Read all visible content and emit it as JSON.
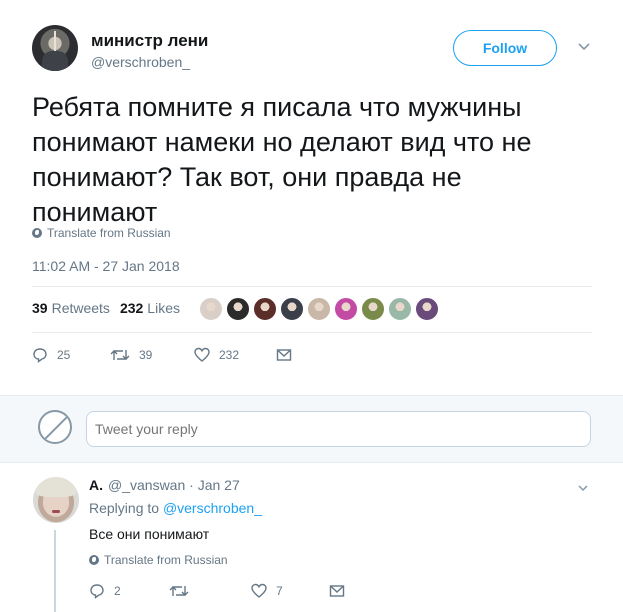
{
  "tweet": {
    "display_name": "министр лени",
    "handle": "@verschroben_",
    "follow_label": "Follow",
    "text": "Ребята помните я писала что мужчины понимают намеки но делают вид что не понимают? Так вот, они правда не понимают",
    "translate_label": "Translate from Russian",
    "timestamp": "11:02 AM - 27 Jan 2018",
    "retweets_count": "39",
    "retweets_label": "Retweets",
    "likes_count": "232",
    "likes_label": "Likes",
    "actions": {
      "replies": "25",
      "retweets": "39",
      "likes": "232"
    },
    "liker_colors": [
      "#d9cfc8",
      "#2b2b2b",
      "#5b2e2a",
      "#3a3f4a",
      "#c9b8a8",
      "#c44ba3",
      "#7a8a4a",
      "#9ab8a8",
      "#6a4a7a"
    ]
  },
  "reply_box": {
    "placeholder": "Tweet your reply"
  },
  "reply": {
    "name": "A.",
    "meta": "@_vanswan · Jan 27",
    "replying_prefix": "Replying to",
    "replying_to": "@verschroben_",
    "text": "Все они понимают",
    "translate_label": "Translate from Russian",
    "actions": {
      "replies": "2",
      "retweets": "",
      "likes": "7"
    }
  },
  "colors": {
    "accent": "#1da1f2",
    "muted": "#657786",
    "text": "#14171a",
    "divider": "#e6ecf0",
    "band": "#f5f8fa"
  }
}
